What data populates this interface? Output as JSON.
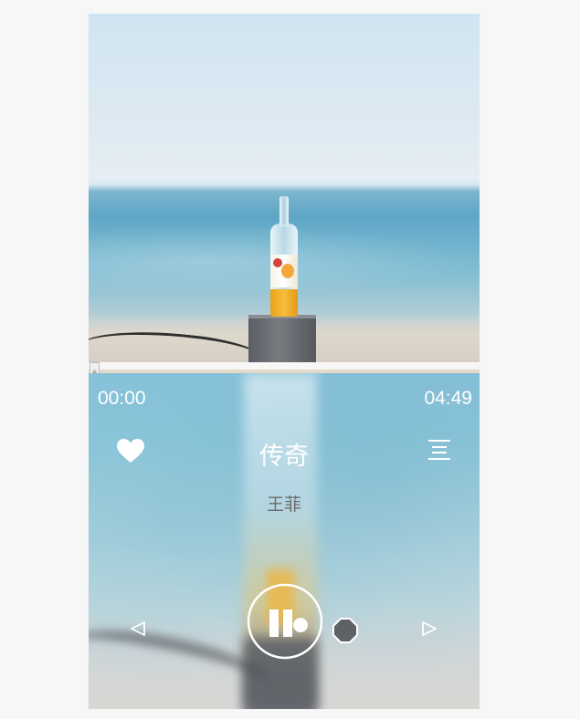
{
  "player": {
    "current_time": "00:00",
    "total_time": "04:49",
    "song_title": "传奇",
    "artist": "王菲",
    "progress": 0,
    "progress_handle_glyph": "≡",
    "liked": true
  },
  "icons": {
    "like": "heart-icon",
    "menu": "playlist-menu-icon",
    "prev": "previous-icon",
    "next": "next-icon",
    "play_pause": "pause-icon",
    "stop": "stop-icon"
  },
  "colors": {
    "text_light": "#ffffff",
    "artist_text": "#6b6b6b",
    "progress_track": "#e3d9c8"
  }
}
